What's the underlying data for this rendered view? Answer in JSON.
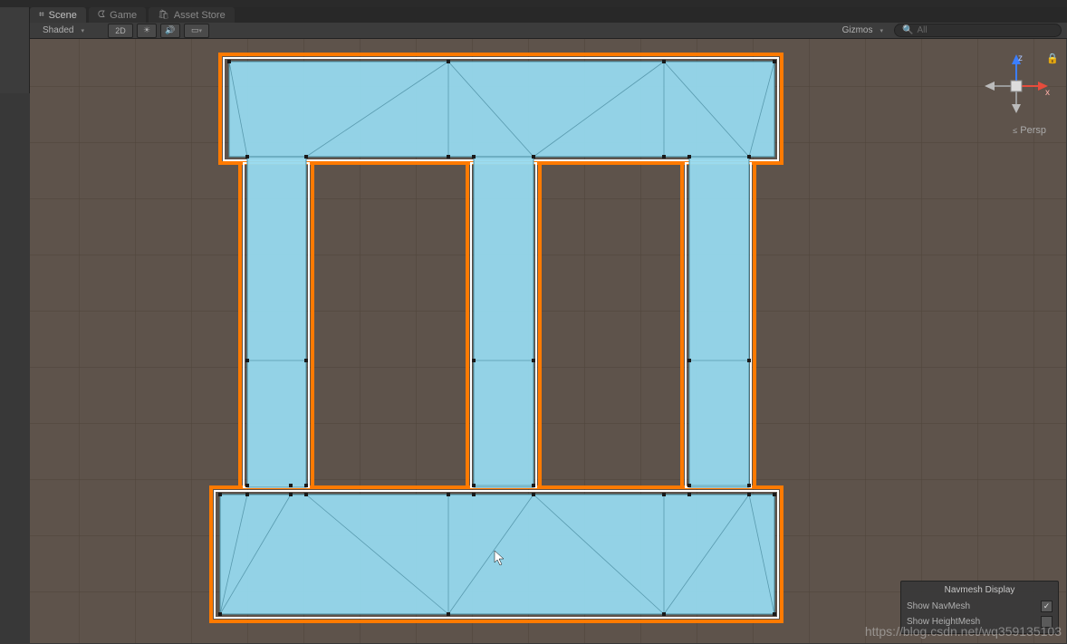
{
  "tabs": {
    "scene": "Scene",
    "game": "Game",
    "assetStore": "Asset Store"
  },
  "toolbar": {
    "shadingMode": "Shaded",
    "mode2d": "2D",
    "gizmos": "Gizmos",
    "searchPlaceholder": "All"
  },
  "axisGizmo": {
    "xLabel": "x",
    "zLabel": "z",
    "perspLabel": "Persp"
  },
  "navmeshPanel": {
    "title": "Navmesh Display",
    "showNavMesh": {
      "label": "Show NavMesh",
      "checked": true
    },
    "showHeightMesh": {
      "label": "Show HeightMesh",
      "checked": false
    }
  },
  "watermark": "https://blog.csdn.net/wq359135103",
  "colors": {
    "navmesh": "#8bd4ec",
    "selection": "#ff7a00",
    "background": "#5e534b"
  }
}
